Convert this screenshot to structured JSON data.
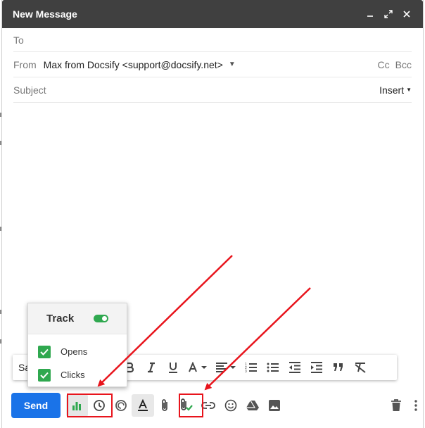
{
  "window": {
    "title": "New Message",
    "controls": {
      "minimize": "minimize-icon",
      "popout": "expand-icon",
      "close": "close-icon"
    }
  },
  "fields": {
    "to_label": "To",
    "from_label": "From",
    "from_value": "Max from Docsify <support@docsify.net>",
    "cc_label": "Cc",
    "bcc_label": "Bcc",
    "subject_placeholder": "Subject",
    "insert_label": "Insert"
  },
  "format_toolbar": {
    "font_value": "Sa",
    "buttons": [
      "bold-icon",
      "italic-icon",
      "underline-icon",
      "text-color-icon",
      "align-icon",
      "numbered-list-icon",
      "bulleted-list-icon",
      "indent-less-icon",
      "indent-more-icon",
      "quote-icon",
      "remove-formatting-icon"
    ]
  },
  "bottom_toolbar": {
    "send_label": "Send",
    "icons": [
      "track-chart-icon",
      "schedule-clock-icon",
      "docsify-icon",
      "formatting-icon",
      "attach-icon",
      "secure-attach-icon",
      "link-icon",
      "emoji-icon",
      "drive-icon",
      "photo-icon",
      "trash-icon",
      "more-options-icon"
    ]
  },
  "track_popup": {
    "title": "Track",
    "toggle_on": true,
    "options": [
      {
        "label": "Opens",
        "checked": true
      },
      {
        "label": "Clicks",
        "checked": true
      }
    ]
  },
  "colors": {
    "titlebar": "#404040",
    "send": "#1a73e8",
    "track_green": "#2fa84f",
    "annotation_red": "#e8141c"
  }
}
